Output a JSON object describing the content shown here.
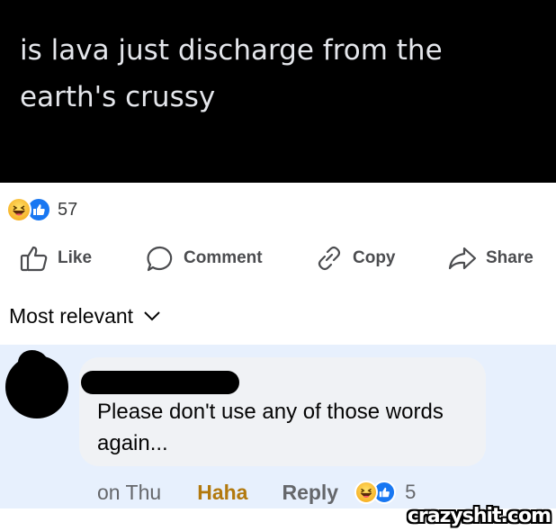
{
  "post": {
    "text": "is lava just discharge from the earth's crussy"
  },
  "reactions": {
    "icons": [
      "haha-icon",
      "like-icon"
    ],
    "count": "57"
  },
  "actions": {
    "like": "Like",
    "comment": "Comment",
    "copy": "Copy",
    "share": "Share"
  },
  "sort": {
    "label": "Most relevant"
  },
  "comment": {
    "text": "Please don't use any of those words again...",
    "time": "on Thu",
    "haha_label": "Haha",
    "reply_label": "Reply",
    "reaction_count": "5"
  },
  "watermark": {
    "text": "crazyshit.com"
  },
  "colors": {
    "banner_bg": "#000000",
    "comment_highlight": "#e7f0fd",
    "bubble_bg": "#f0f2f5",
    "like_blue": "#1877f2",
    "haha_gold": "#b2790e"
  }
}
